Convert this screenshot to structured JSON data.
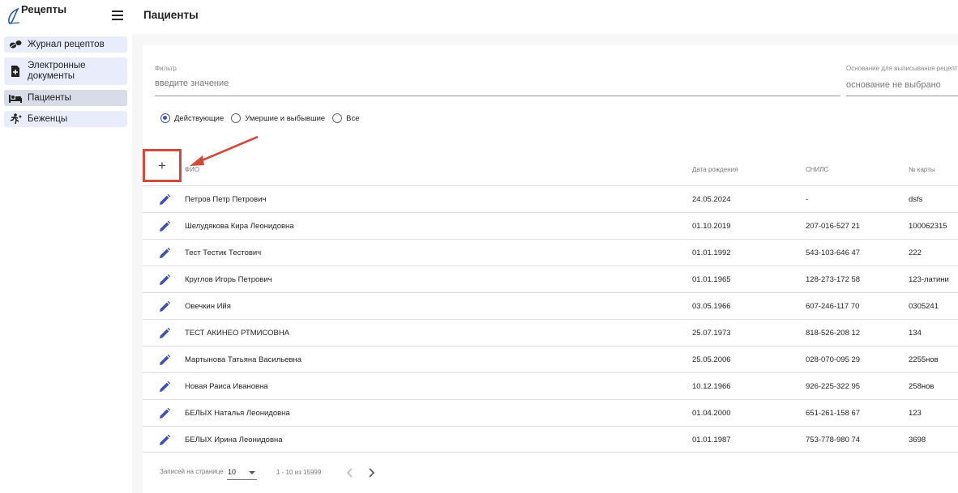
{
  "app": {
    "title": "Рецепты"
  },
  "sidebar": {
    "items": [
      {
        "label": "Журнал рецептов",
        "icon": "pills-icon"
      },
      {
        "label": "Электронные документы",
        "icon": "document-add-icon"
      },
      {
        "label": "Пациенты",
        "icon": "bed-icon",
        "active": true
      },
      {
        "label": "Беженцы",
        "icon": "running-person-icon"
      }
    ]
  },
  "header": {
    "title": "Пациенты"
  },
  "filters": {
    "filter_label": "Фильтр",
    "filter_placeholder": "введите значение",
    "basis_label": "Основание для выписывания рецептов",
    "basis_placeholder": "основание не выбрано"
  },
  "radios": [
    {
      "label": "Действующие",
      "checked": true
    },
    {
      "label": "Умершие и выбывшие",
      "checked": false
    },
    {
      "label": "Все",
      "checked": false
    }
  ],
  "table": {
    "add_label": "+",
    "columns": [
      "ФИО",
      "Дата рождения",
      "СНИЛС",
      "№ карты"
    ],
    "rows": [
      {
        "fio": "Петров Петр Петрович",
        "dob": "24.05.2024",
        "snils": "-",
        "card": "dsfs"
      },
      {
        "fio": "Шелудякова Кира Леонидовна",
        "dob": "01.10.2019",
        "snils": "207-016-527 21",
        "card": "100062315"
      },
      {
        "fio": "Тест Тестик Тестович",
        "dob": "01.01.1992",
        "snils": "543-103-646 47",
        "card": "222"
      },
      {
        "fio": "Круглов Игорь Петрович",
        "dob": "01.01.1965",
        "snils": "128-273-172 58",
        "card": "123-латини"
      },
      {
        "fio": "Овечкин Ийя",
        "dob": "03.05.1966",
        "snils": "607-246-117 70",
        "card": "0305241"
      },
      {
        "fio": "ТЕСТ АКИНЕО РТМИСОВНА",
        "dob": "25.07.1973",
        "snils": "818-526-208 12",
        "card": "134"
      },
      {
        "fio": "Мартынова Татьяна Васильевна",
        "dob": "25.05.2006",
        "snils": "028-070-095 29",
        "card": "2255нов"
      },
      {
        "fio": "Новая Раиса Ивановна",
        "dob": "10.12.1966",
        "snils": "926-225-322 95",
        "card": "258нов"
      },
      {
        "fio": "БЕЛЫХ Наталья Леонидовна",
        "dob": "01.04.2000",
        "snils": "651-261-158 67",
        "card": "123"
      },
      {
        "fio": "БЕЛЫХ Ирина Леонидовна",
        "dob": "01.01.1987",
        "snils": "753-778-980 74",
        "card": "3698"
      }
    ]
  },
  "pager": {
    "rows_per_page_label": "Записей на странице",
    "rows_per_page": "10",
    "range": "1 - 10 из 15999"
  },
  "colors": {
    "accent": "#3f51b5",
    "highlight": "#d34a3b",
    "nav_bg": "#e8ecfb"
  }
}
